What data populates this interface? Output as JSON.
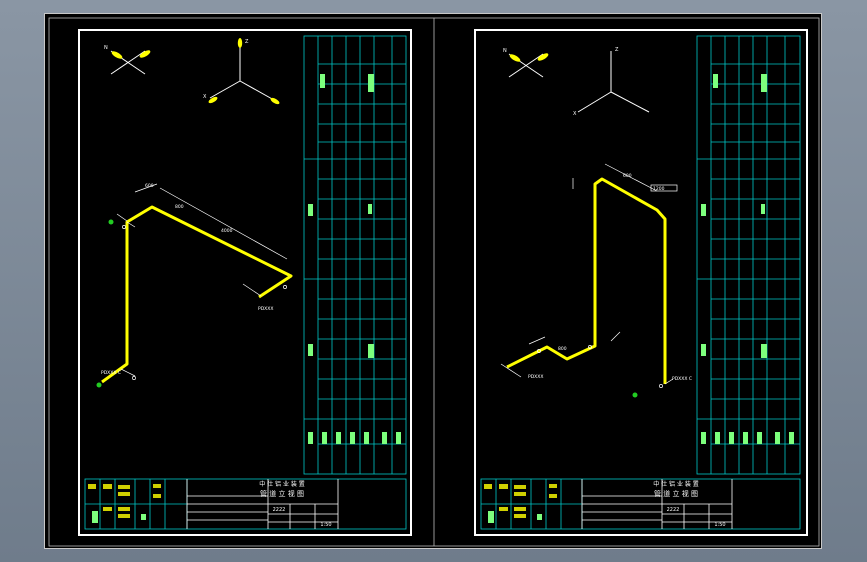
{
  "sheets": [
    {
      "id": "left",
      "title_block": {
        "company": "中 仕 铝 业 装 置",
        "drawing_title": "管 道 立 视 图",
        "code": "2222",
        "scale": "1:50",
        "side_labels": [
          "日期",
          "审核",
          "校对",
          "设计",
          "制图"
        ]
      },
      "axes": {
        "north": "N",
        "z": "Z",
        "x": "X"
      },
      "labels": {
        "inlet_tag": "PDXXX C",
        "outlet_tag": "PDXXX",
        "dim_a": "600",
        "dim_b": "800",
        "dim_c": "4000"
      }
    },
    {
      "id": "right",
      "title_block": {
        "company": "中 仕 铝 业 装 置",
        "drawing_title": "管 道 立 视 图",
        "code": "2222",
        "scale": "1:50",
        "side_labels": [
          "日期",
          "审核",
          "校对",
          "设计",
          "制图"
        ]
      },
      "axes": {
        "north": "N",
        "z": "Z",
        "x": "X"
      },
      "labels": {
        "inlet_tag": "PDXXX C",
        "outlet_tag": "PDXXX",
        "dim_a": "600",
        "dim_b": "800",
        "dim_c": "1200"
      }
    }
  ],
  "colors": {
    "background": "#000000",
    "frame": "#ffffff",
    "grid": "#00c8c8",
    "pipe": "#ffff00",
    "valve": "#22cc22",
    "text": "#ffffff"
  }
}
